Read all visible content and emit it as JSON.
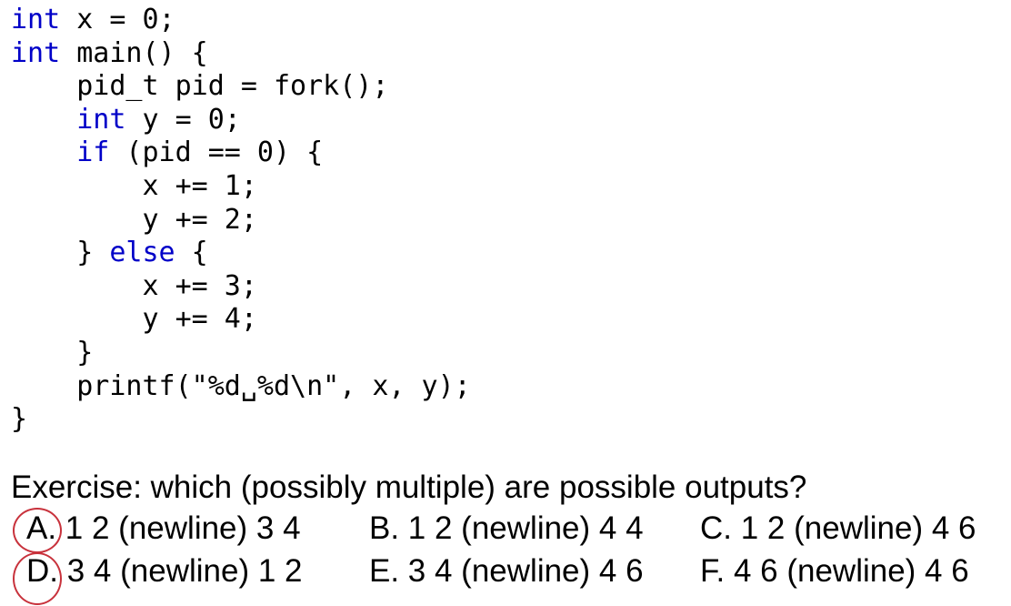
{
  "code": {
    "lines": [
      [
        {
          "t": "int",
          "kw": true
        },
        {
          "t": " x = 0;",
          "kw": false
        }
      ],
      [
        {
          "t": "int",
          "kw": true
        },
        {
          "t": " main() {",
          "kw": false
        }
      ],
      [
        {
          "t": "    pid_t pid = fork();",
          "kw": false
        }
      ],
      [
        {
          "t": "    ",
          "kw": false
        },
        {
          "t": "int",
          "kw": true
        },
        {
          "t": " y = 0;",
          "kw": false
        }
      ],
      [
        {
          "t": "    ",
          "kw": false
        },
        {
          "t": "if",
          "kw": true
        },
        {
          "t": " (pid == 0) {",
          "kw": false
        }
      ],
      [
        {
          "t": "        x += 1;",
          "kw": false
        }
      ],
      [
        {
          "t": "        y += 2;",
          "kw": false
        }
      ],
      [
        {
          "t": "    } ",
          "kw": false
        },
        {
          "t": "else",
          "kw": true
        },
        {
          "t": " {",
          "kw": false
        }
      ],
      [
        {
          "t": "        x += 3;",
          "kw": false
        }
      ],
      [
        {
          "t": "        y += 4;",
          "kw": false
        }
      ],
      [
        {
          "t": "    }",
          "kw": false
        }
      ],
      [
        {
          "t": "    printf(\"%d␣%d\\n\", x, y);",
          "kw": false
        }
      ],
      [
        {
          "t": "}",
          "kw": false
        }
      ]
    ],
    "keyword_color": "#0000c8",
    "text_color": "#000000"
  },
  "exercise": {
    "question": "Exercise: which (possibly multiple) are possible outputs?",
    "options": [
      {
        "letter": "A.",
        "text": " 1 2 (newline) 3 4",
        "circled": true
      },
      {
        "letter": "B.",
        "text": " 1 2 (newline) 4 4",
        "circled": false
      },
      {
        "letter": "C.",
        "text": " 1 2 (newline) 4 6",
        "circled": false
      },
      {
        "letter": "D.",
        "text": " 3 4 (newline) 1 2",
        "circled": true
      },
      {
        "letter": "E.",
        "text": " 3 4 (newline) 4 6",
        "circled": false
      },
      {
        "letter": "F.",
        "text": " 4 6 (newline) 4 6",
        "circled": false
      }
    ],
    "circle_color": "#c8323c"
  }
}
